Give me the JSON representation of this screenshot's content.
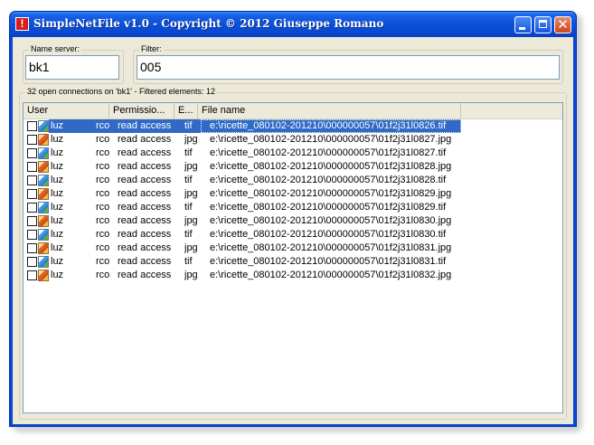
{
  "window": {
    "title": "SimpleNetFile v1.0 - Copyright © 2012 Giuseppe Romano",
    "app_icon_glyph": "!",
    "minimize_icon": "minimize-icon",
    "maximize_icon": "maximize-icon",
    "close_glyph": "✕"
  },
  "name_server": {
    "label": "Name server:",
    "value": "bk1"
  },
  "filter": {
    "label": "Filter:",
    "value": "005"
  },
  "connections": {
    "summary": "32 open connections on 'bk1' - Filtered elements: 12"
  },
  "table": {
    "columns": [
      "User",
      "Permissio...",
      "E...",
      "File name"
    ],
    "rows": [
      {
        "user": "luz",
        "user_suffix": "rco",
        "permission": "read access",
        "ext": "tif",
        "file": "e:\\ricette_080102-201210\\000000057\\01f2j31l0826.tif"
      },
      {
        "user": "luz",
        "user_suffix": "rco",
        "permission": "read access",
        "ext": "jpg",
        "file": "e:\\ricette_080102-201210\\000000057\\01f2j31l0827.jpg"
      },
      {
        "user": "luz",
        "user_suffix": "rco",
        "permission": "read access",
        "ext": "tif",
        "file": "e:\\ricette_080102-201210\\000000057\\01f2j31l0827.tif"
      },
      {
        "user": "luz",
        "user_suffix": "rco",
        "permission": "read access",
        "ext": "jpg",
        "file": "e:\\ricette_080102-201210\\000000057\\01f2j31l0828.jpg"
      },
      {
        "user": "luz",
        "user_suffix": "rco",
        "permission": "read access",
        "ext": "tif",
        "file": "e:\\ricette_080102-201210\\000000057\\01f2j31l0828.tif"
      },
      {
        "user": "luz",
        "user_suffix": "rco",
        "permission": "read access",
        "ext": "jpg",
        "file": "e:\\ricette_080102-201210\\000000057\\01f2j31l0829.jpg"
      },
      {
        "user": "luz",
        "user_suffix": "rco",
        "permission": "read access",
        "ext": "tif",
        "file": "e:\\ricette_080102-201210\\000000057\\01f2j31l0829.tif"
      },
      {
        "user": "luz",
        "user_suffix": "rco",
        "permission": "read access",
        "ext": "jpg",
        "file": "e:\\ricette_080102-201210\\000000057\\01f2j31l0830.jpg"
      },
      {
        "user": "luz",
        "user_suffix": "rco",
        "permission": "read access",
        "ext": "tif",
        "file": "e:\\ricette_080102-201210\\000000057\\01f2j31l0830.tif"
      },
      {
        "user": "luz",
        "user_suffix": "rco",
        "permission": "read access",
        "ext": "jpg",
        "file": "e:\\ricette_080102-201210\\000000057\\01f2j31l0831.jpg"
      },
      {
        "user": "luz",
        "user_suffix": "rco",
        "permission": "read access",
        "ext": "tif",
        "file": "e:\\ricette_080102-201210\\000000057\\01f2j31l0831.tif"
      },
      {
        "user": "luz",
        "user_suffix": "rco",
        "permission": "read access",
        "ext": "jpg",
        "file": "e:\\ricette_080102-201210\\000000057\\01f2j31l0832.jpg"
      }
    ],
    "selected_row": 0
  },
  "colors": {
    "title_blue": "#0a50d8",
    "selection": "#316ac5",
    "face": "#ece9d8"
  }
}
